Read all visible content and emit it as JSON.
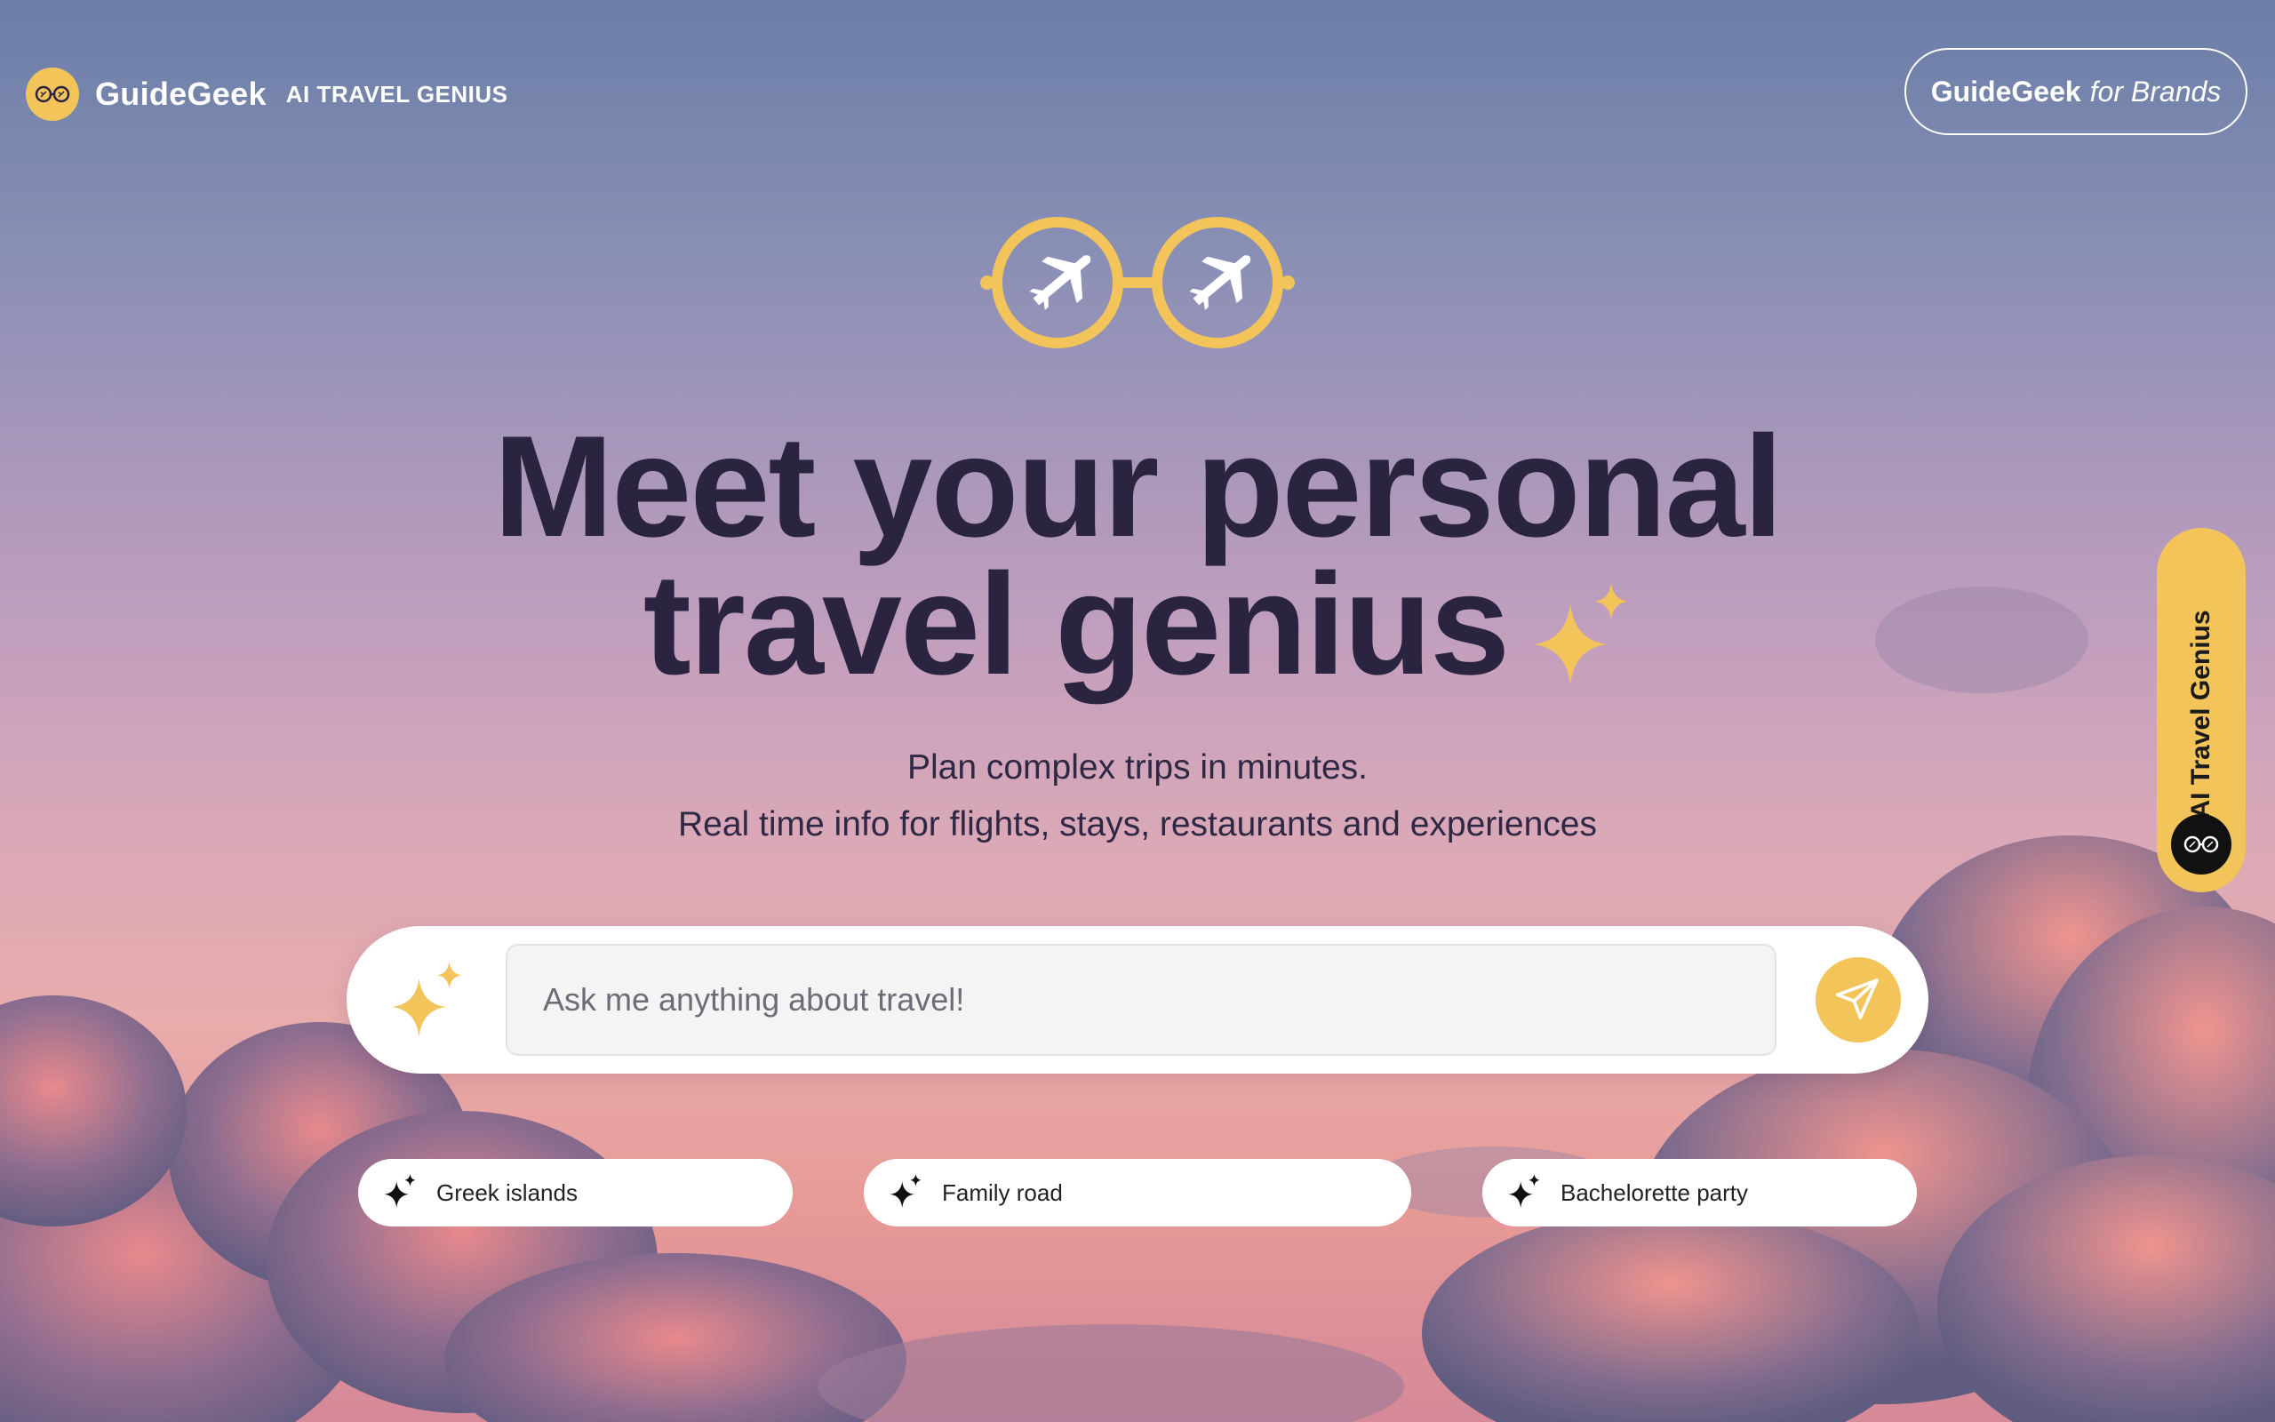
{
  "brand": {
    "name": "GuideGeek",
    "tagline": "AI TRAVEL GENIUS"
  },
  "header": {
    "brands_button": {
      "part1": "GuideGeek",
      "part2": "for Brands"
    }
  },
  "hero": {
    "headline_line1": "Meet your personal",
    "headline_line2": "travel genius",
    "subtitle_line1": "Plan complex trips in minutes.",
    "subtitle_line2": "Real time info for flights, stays, restaurants and experiences"
  },
  "chat": {
    "placeholder": "Ask me anything about travel!"
  },
  "suggestions": [
    {
      "label": "Greek islands"
    },
    {
      "label": "Family road"
    },
    {
      "label": "Bachelorette party"
    }
  ],
  "side_tab": {
    "label": "AI Travel Genius"
  },
  "colors": {
    "accent": "#f2c45a",
    "headline": "#2b2440",
    "white": "#ffffff"
  },
  "icons": [
    "glasses-logo-icon",
    "airplane-icon",
    "sparkle-icon",
    "send-icon"
  ]
}
